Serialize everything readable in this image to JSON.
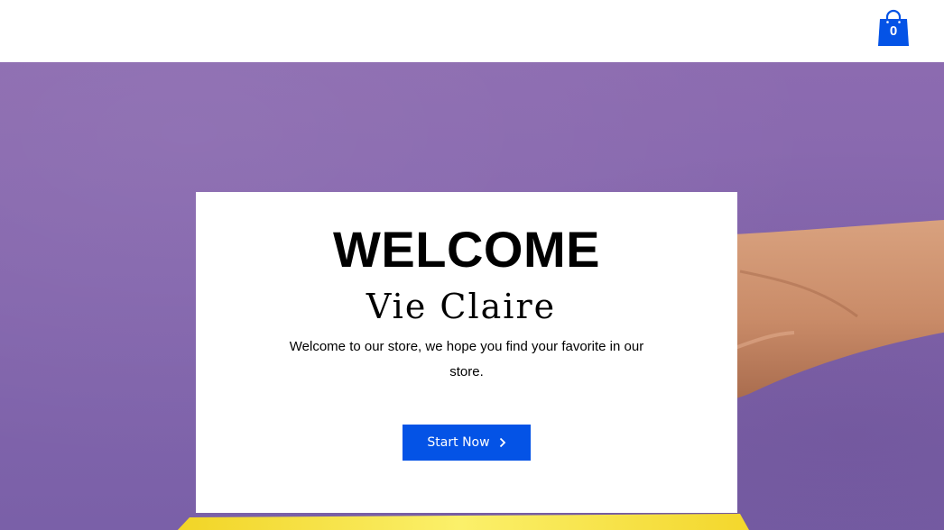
{
  "header": {
    "cart": {
      "count": "0",
      "icon": "shopping-bag-icon",
      "color": "#0453e6"
    }
  },
  "hero": {
    "background_color": "#8466ad",
    "title": "WELCOME",
    "brand": "Vie Claire",
    "intro": "Welcome to our store, we hope you find your favorite in our store.",
    "cta": {
      "label": "Start Now",
      "icon": "chevron-right-icon",
      "color": "#0453e6"
    }
  }
}
